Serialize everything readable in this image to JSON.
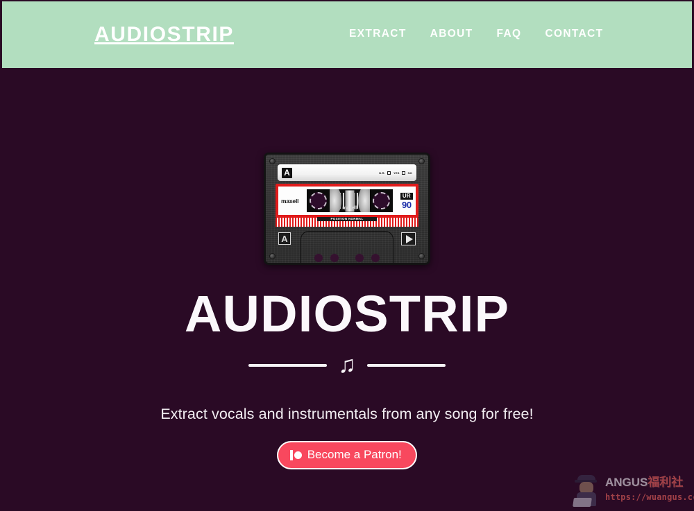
{
  "theme": {
    "header_bg": "#b2debf",
    "page_bg": "#2a0a25",
    "text_light": "#ffffff",
    "accent_patreon": "#f8485e",
    "cassette_red": "#e01b1b",
    "cassette_blue": "#1b2ea8"
  },
  "header": {
    "brand": "AUDIOSTRIP",
    "nav": [
      {
        "label": "EXTRACT"
      },
      {
        "label": "ABOUT"
      },
      {
        "label": "FAQ"
      },
      {
        "label": "CONTACT"
      }
    ]
  },
  "hero": {
    "title": "AUDIOSTRIP",
    "divider_icon": "♫",
    "tagline": "Extract vocals and instrumentals from any song for free!",
    "patreon_label": "Become a Patron!"
  },
  "cassette": {
    "side_label": "A",
    "strip_meta_na": "N.R.",
    "strip_meta_yes": "YES",
    "strip_meta_no": "NO",
    "brand": "maxell",
    "tape_brand": "maxell",
    "type_tag": "UR",
    "length": "90",
    "position_text": "POSITION NORMAL",
    "deck_side": "A"
  },
  "watermark": {
    "line1_latin": "ANGUS",
    "line1_cjk": "福利社",
    "line2": "https://wuangus.cc"
  }
}
